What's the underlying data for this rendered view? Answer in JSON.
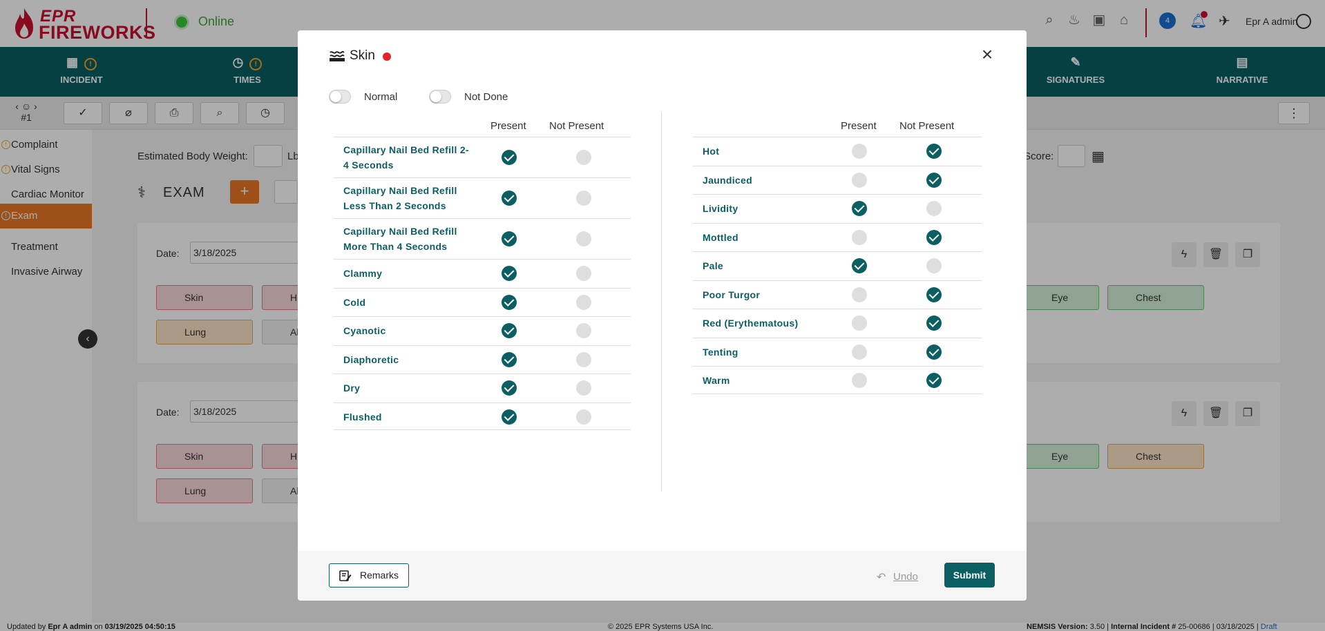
{
  "app": {
    "logo_top": "EPR",
    "logo_bottom": "FIREWORKS",
    "status": "Online",
    "chat_count": "4",
    "user_name": "Epr A admin"
  },
  "nav": {
    "incident": "INCIDENT",
    "times": "TIMES",
    "signatures": "SIGNATURES",
    "narrative": "NARRATIVE",
    "warn_glyph": "!"
  },
  "toolbar": {
    "patient_label": "#1",
    "more_glyph": "⋮"
  },
  "sidebar": {
    "items": [
      "Complaint",
      "Vital Signs",
      "Cardiac Monitor",
      "Exam",
      "Treatment",
      "Invasive Airway"
    ],
    "toggle_glyph": "‹"
  },
  "main": {
    "weight_label": "Estimated Body Weight:",
    "weight_unit": "Lb",
    "score_label": "Score:",
    "exam_title": "EXAM",
    "add_glyph": "+",
    "date_label": "Date:",
    "cards": [
      {
        "date": "3/18/2025"
      },
      {
        "date": "3/18/2025"
      }
    ],
    "chips": {
      "skin": "Skin",
      "head": "H",
      "lung": "Lung",
      "abdomen": "Al",
      "eye": "Eye",
      "chest": "Chest"
    }
  },
  "footer": {
    "updated_prefix": "Updated by ",
    "updated_user": "Epr A admin",
    "updated_on": " on ",
    "updated_time": "03/19/2025 04:50:15",
    "copyright": "© 2025 EPR Systems USA Inc.",
    "nemsis_label": "NEMSIS Version:",
    "nemsis_value": " 3.50 | ",
    "incident_label": "Internal Incident #",
    "incident_value": " 25-00686 | 03/18/2025 | ",
    "status": "Draft"
  },
  "modal": {
    "title": "Skin",
    "close_glyph": "×",
    "toggles": {
      "normal": "Normal",
      "not_done": "Not Done"
    },
    "headers": {
      "present": "Present",
      "not_present": "Not Present"
    },
    "left_rows": [
      {
        "label": "Capillary Nail Bed Refill 2-",
        "label2": "4 Seconds",
        "present": true
      },
      {
        "label": "Capillary Nail Bed Refill",
        "label2": "Less Than 2 Seconds",
        "present": true
      },
      {
        "label": "Capillary Nail Bed Refill",
        "label2": "More Than 4 Seconds",
        "present": true
      },
      {
        "label": "Clammy",
        "present": true
      },
      {
        "label": "Cold",
        "present": true
      },
      {
        "label": "Cyanotic",
        "present": true
      },
      {
        "label": "Diaphoretic",
        "present": true
      },
      {
        "label": "Dry",
        "present": true
      },
      {
        "label": "Flushed",
        "present": true
      }
    ],
    "right_rows": [
      {
        "label": "Hot",
        "present": false
      },
      {
        "label": "Jaundiced",
        "present": false
      },
      {
        "label": "Lividity",
        "present": true
      },
      {
        "label": "Mottled",
        "present": false
      },
      {
        "label": "Pale",
        "present": true
      },
      {
        "label": "Poor Turgor",
        "present": false
      },
      {
        "label": "Red (Erythematous)",
        "present": false
      },
      {
        "label": "Tenting",
        "present": false
      },
      {
        "label": "Warm",
        "present": false
      }
    ],
    "remarks_label": "Remarks",
    "undo_label": "Undo",
    "undo_glyph": "↶",
    "submit_label": "Submit"
  },
  "colors": {
    "brand_teal": "#0b5f63",
    "brand_red": "#c8102e",
    "accent_orange": "#e87722",
    "status_dot": "#e3242b"
  }
}
